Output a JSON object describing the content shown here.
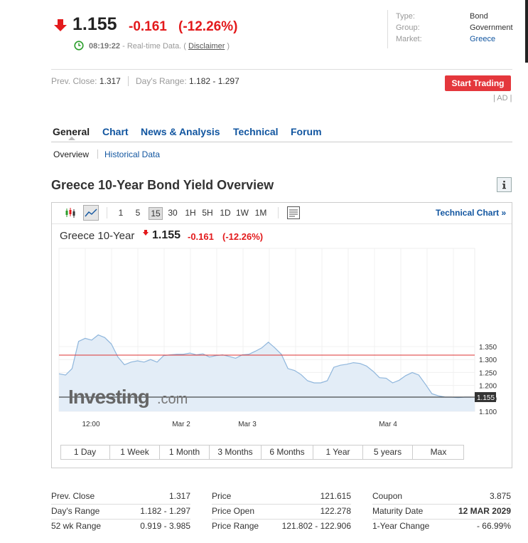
{
  "quote": {
    "last": "1.155",
    "change": "-0.161",
    "change_pct": "(-12.26%)",
    "time": "08:19:22",
    "time_text": " - Real-time Data. ( ",
    "disclaimer": "Disclaimer",
    "time_close": " )"
  },
  "info": {
    "type_label": "Type:",
    "type_value": "Bond",
    "group_label": "Group:",
    "group_value": "Government",
    "market_label": "Market:",
    "market_value": "Greece"
  },
  "ranges": {
    "prev_close_label": "Prev. Close:",
    "prev_close_value": "1.317",
    "days_range_label": "Day's Range:",
    "days_range_value": "1.182 - 1.297"
  },
  "start_trading": "Start Trading",
  "ad": "| AD |",
  "tabs": [
    "General",
    "Chart",
    "News & Analysis",
    "Technical",
    "Forum"
  ],
  "subtabs": [
    "Overview",
    "Historical Data"
  ],
  "section_title": "Greece 10-Year Bond Yield Overview",
  "toolbar": {
    "intervals": [
      "1",
      "5",
      "15",
      "30",
      "1H",
      "5H",
      "1D",
      "1W",
      "1M"
    ],
    "selected_interval": "15",
    "technical_chart": "Technical Chart »"
  },
  "chart_header": {
    "name": "Greece 10-Year",
    "last": "1.155",
    "change": "-0.161",
    "change_pct": "(-12.26%)"
  },
  "watermark": {
    "brand": "Investing",
    "suffix": ".com"
  },
  "chart_data": {
    "type": "area",
    "y_ticks": [
      "1.350",
      "1.300",
      "1.250",
      "1.200",
      "1.150",
      "1.100"
    ],
    "ylim": [
      1.1,
      1.4
    ],
    "x_ticks": [
      "12:00",
      "Mar 2",
      "Mar 3",
      "Mar 4"
    ],
    "prev_close": 1.317,
    "last_label": "1.155",
    "series": [
      {
        "values": [
          1.245,
          1.24,
          1.265,
          1.37,
          1.382,
          1.375,
          1.395,
          1.385,
          1.36,
          1.31,
          1.28,
          1.29,
          1.295,
          1.29,
          1.3,
          1.29,
          1.315,
          1.318,
          1.32,
          1.32,
          1.325,
          1.318,
          1.322,
          1.31,
          1.315,
          1.318,
          1.312,
          1.305,
          1.318,
          1.32,
          1.332,
          1.345,
          1.367,
          1.345,
          1.32,
          1.265,
          1.258,
          1.242,
          1.218,
          1.21,
          1.21,
          1.218,
          1.27,
          1.278,
          1.282,
          1.288,
          1.285,
          1.275,
          1.255,
          1.23,
          1.228,
          1.21,
          1.22,
          1.238,
          1.25,
          1.24,
          1.205,
          1.168,
          1.16,
          1.155,
          1.155,
          1.153,
          1.155,
          1.155
        ]
      }
    ],
    "grid": true
  },
  "range_tabs": [
    "1 Day",
    "1 Week",
    "1 Month",
    "3 Months",
    "6 Months",
    "1 Year",
    "5 years",
    "Max"
  ],
  "table": {
    "col1": [
      {
        "label": "Prev. Close",
        "value": "1.317"
      },
      {
        "label": "Day's Range",
        "value": "1.182 - 1.297"
      },
      {
        "label": "52 wk Range",
        "value": "0.919 - 3.985"
      }
    ],
    "col2": [
      {
        "label": "Price",
        "value": "121.615"
      },
      {
        "label": "Price Open",
        "value": "122.278"
      },
      {
        "label": "Price Range",
        "value": "121.802 - 122.906"
      }
    ],
    "col3": [
      {
        "label": "Coupon",
        "value": "3.875"
      },
      {
        "label": "Maturity Date",
        "value": "12 MAR 2029"
      },
      {
        "label": "1-Year Change",
        "value": "- 66.99%"
      }
    ]
  },
  "colors": {
    "red": "#e31a1c",
    "link": "#1256a0",
    "button": "#e4373c"
  }
}
